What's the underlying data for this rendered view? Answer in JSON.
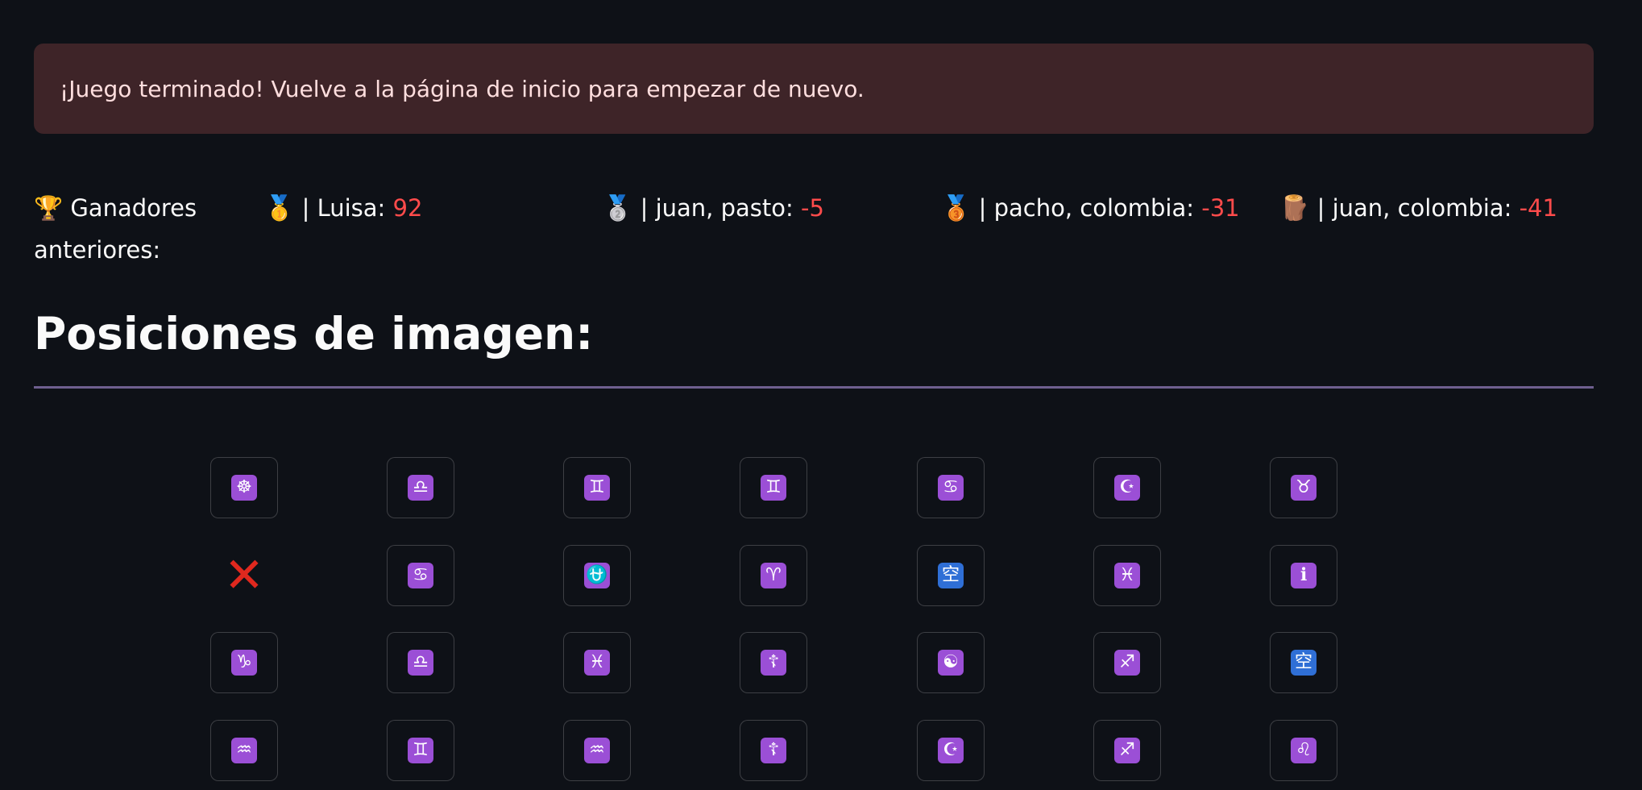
{
  "alert": {
    "text": "¡Juego terminado! Vuelve a la página de inicio para empezar de nuevo."
  },
  "winners": {
    "label": "🏆 Ganadores anteriores:",
    "entries": [
      {
        "medal": "🥇",
        "sep": " | ",
        "name": "Luisa: ",
        "score": "92"
      },
      {
        "medal": "🥈",
        "sep": " | ",
        "name": "juan, pasto: ",
        "score": "-5"
      },
      {
        "medal": "🥉",
        "sep": " | ",
        "name": "pacho, colombia: ",
        "score": "-31"
      },
      {
        "medal": "🪵",
        "sep": " | ",
        "name": "juan, colombia: ",
        "score": "-41"
      }
    ]
  },
  "heading": "Posiciones de imagen:",
  "board": {
    "rows": [
      [
        {
          "glyph": "☸",
          "icon": "wheel-of-dharma-icon"
        },
        {
          "glyph": "♎",
          "icon": "libra-icon"
        },
        {
          "glyph": "♊",
          "icon": "gemini-icon"
        },
        {
          "glyph": "♊",
          "icon": "gemini-icon"
        },
        {
          "glyph": "♋",
          "icon": "cancer-icon"
        },
        {
          "glyph": "☪",
          "icon": "star-and-crescent-icon"
        },
        {
          "glyph": "♉",
          "icon": "taurus-icon"
        }
      ],
      [
        {
          "glyph": "✕",
          "icon": "cross-mark-icon",
          "removed": true
        },
        {
          "glyph": "♋",
          "icon": "cancer-icon"
        },
        {
          "glyph": "⛎",
          "icon": "ophiuchus-icon"
        },
        {
          "glyph": "♈",
          "icon": "aries-icon"
        },
        {
          "glyph": "空",
          "icon": "vacancy-button-icon",
          "blue": true
        },
        {
          "glyph": "♓",
          "icon": "pisces-icon"
        },
        {
          "glyph": "ℹ",
          "icon": "information-icon"
        }
      ],
      [
        {
          "glyph": "♑",
          "icon": "capricorn-icon"
        },
        {
          "glyph": "♎",
          "icon": "libra-icon"
        },
        {
          "glyph": "♓",
          "icon": "pisces-icon"
        },
        {
          "glyph": "☦",
          "icon": "orthodox-cross-icon"
        },
        {
          "glyph": "☯",
          "icon": "yin-yang-icon"
        },
        {
          "glyph": "♐",
          "icon": "sagittarius-icon"
        },
        {
          "glyph": "空",
          "icon": "vacancy-button-icon",
          "blue": true
        }
      ],
      [
        {
          "glyph": "♒",
          "icon": "aquarius-icon"
        },
        {
          "glyph": "♊",
          "icon": "gemini-icon"
        },
        {
          "glyph": "♒",
          "icon": "aquarius-icon"
        },
        {
          "glyph": "☦",
          "icon": "orthodox-cross-icon"
        },
        {
          "glyph": "☪",
          "icon": "star-and-crescent-icon"
        },
        {
          "glyph": "♐",
          "icon": "sagittarius-icon"
        },
        {
          "glyph": "♌",
          "icon": "leo-icon"
        }
      ]
    ]
  }
}
